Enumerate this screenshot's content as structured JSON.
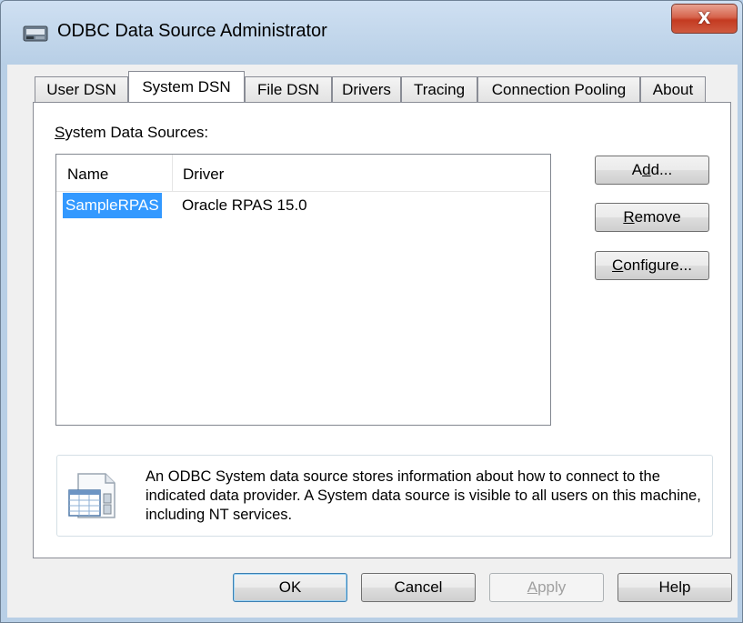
{
  "window": {
    "title": "ODBC Data Source Administrator",
    "close_glyph": "X"
  },
  "tabs": [
    {
      "label": "User DSN",
      "active": false
    },
    {
      "label": "System DSN",
      "active": true
    },
    {
      "label": "File DSN",
      "active": false
    },
    {
      "label": "Drivers",
      "active": false
    },
    {
      "label": "Tracing",
      "active": false
    },
    {
      "label": "Connection Pooling",
      "active": false
    },
    {
      "label": "About",
      "active": false
    }
  ],
  "panel": {
    "list_label": {
      "mnemonic": "S",
      "rest": "ystem Data Sources:"
    },
    "columns": {
      "name": "Name",
      "driver": "Driver"
    },
    "rows": [
      {
        "name": "SampleRPAS",
        "driver": "Oracle RPAS 15.0",
        "selected": true
      }
    ],
    "buttons": {
      "add": {
        "pre": "A",
        "mnemonic": "d",
        "post": "d..."
      },
      "remove": {
        "pre": "",
        "mnemonic": "R",
        "post": "emove"
      },
      "configure": {
        "pre": "",
        "mnemonic": "C",
        "post": "onfigure..."
      }
    },
    "info_text": "An ODBC System data source stores information about how to connect to the indicated data provider.   A System data source is visible to all users on this machine, including NT services.",
    "info_icon": "data-source-info-icon"
  },
  "footer": {
    "ok": "OK",
    "cancel": "Cancel",
    "apply": {
      "mnemonic": "A",
      "rest": "pply"
    },
    "help": "Help"
  },
  "colors": {
    "selection": "#3399ff",
    "close_button": "#c43a21",
    "window_frame": "#b9d1ea"
  }
}
